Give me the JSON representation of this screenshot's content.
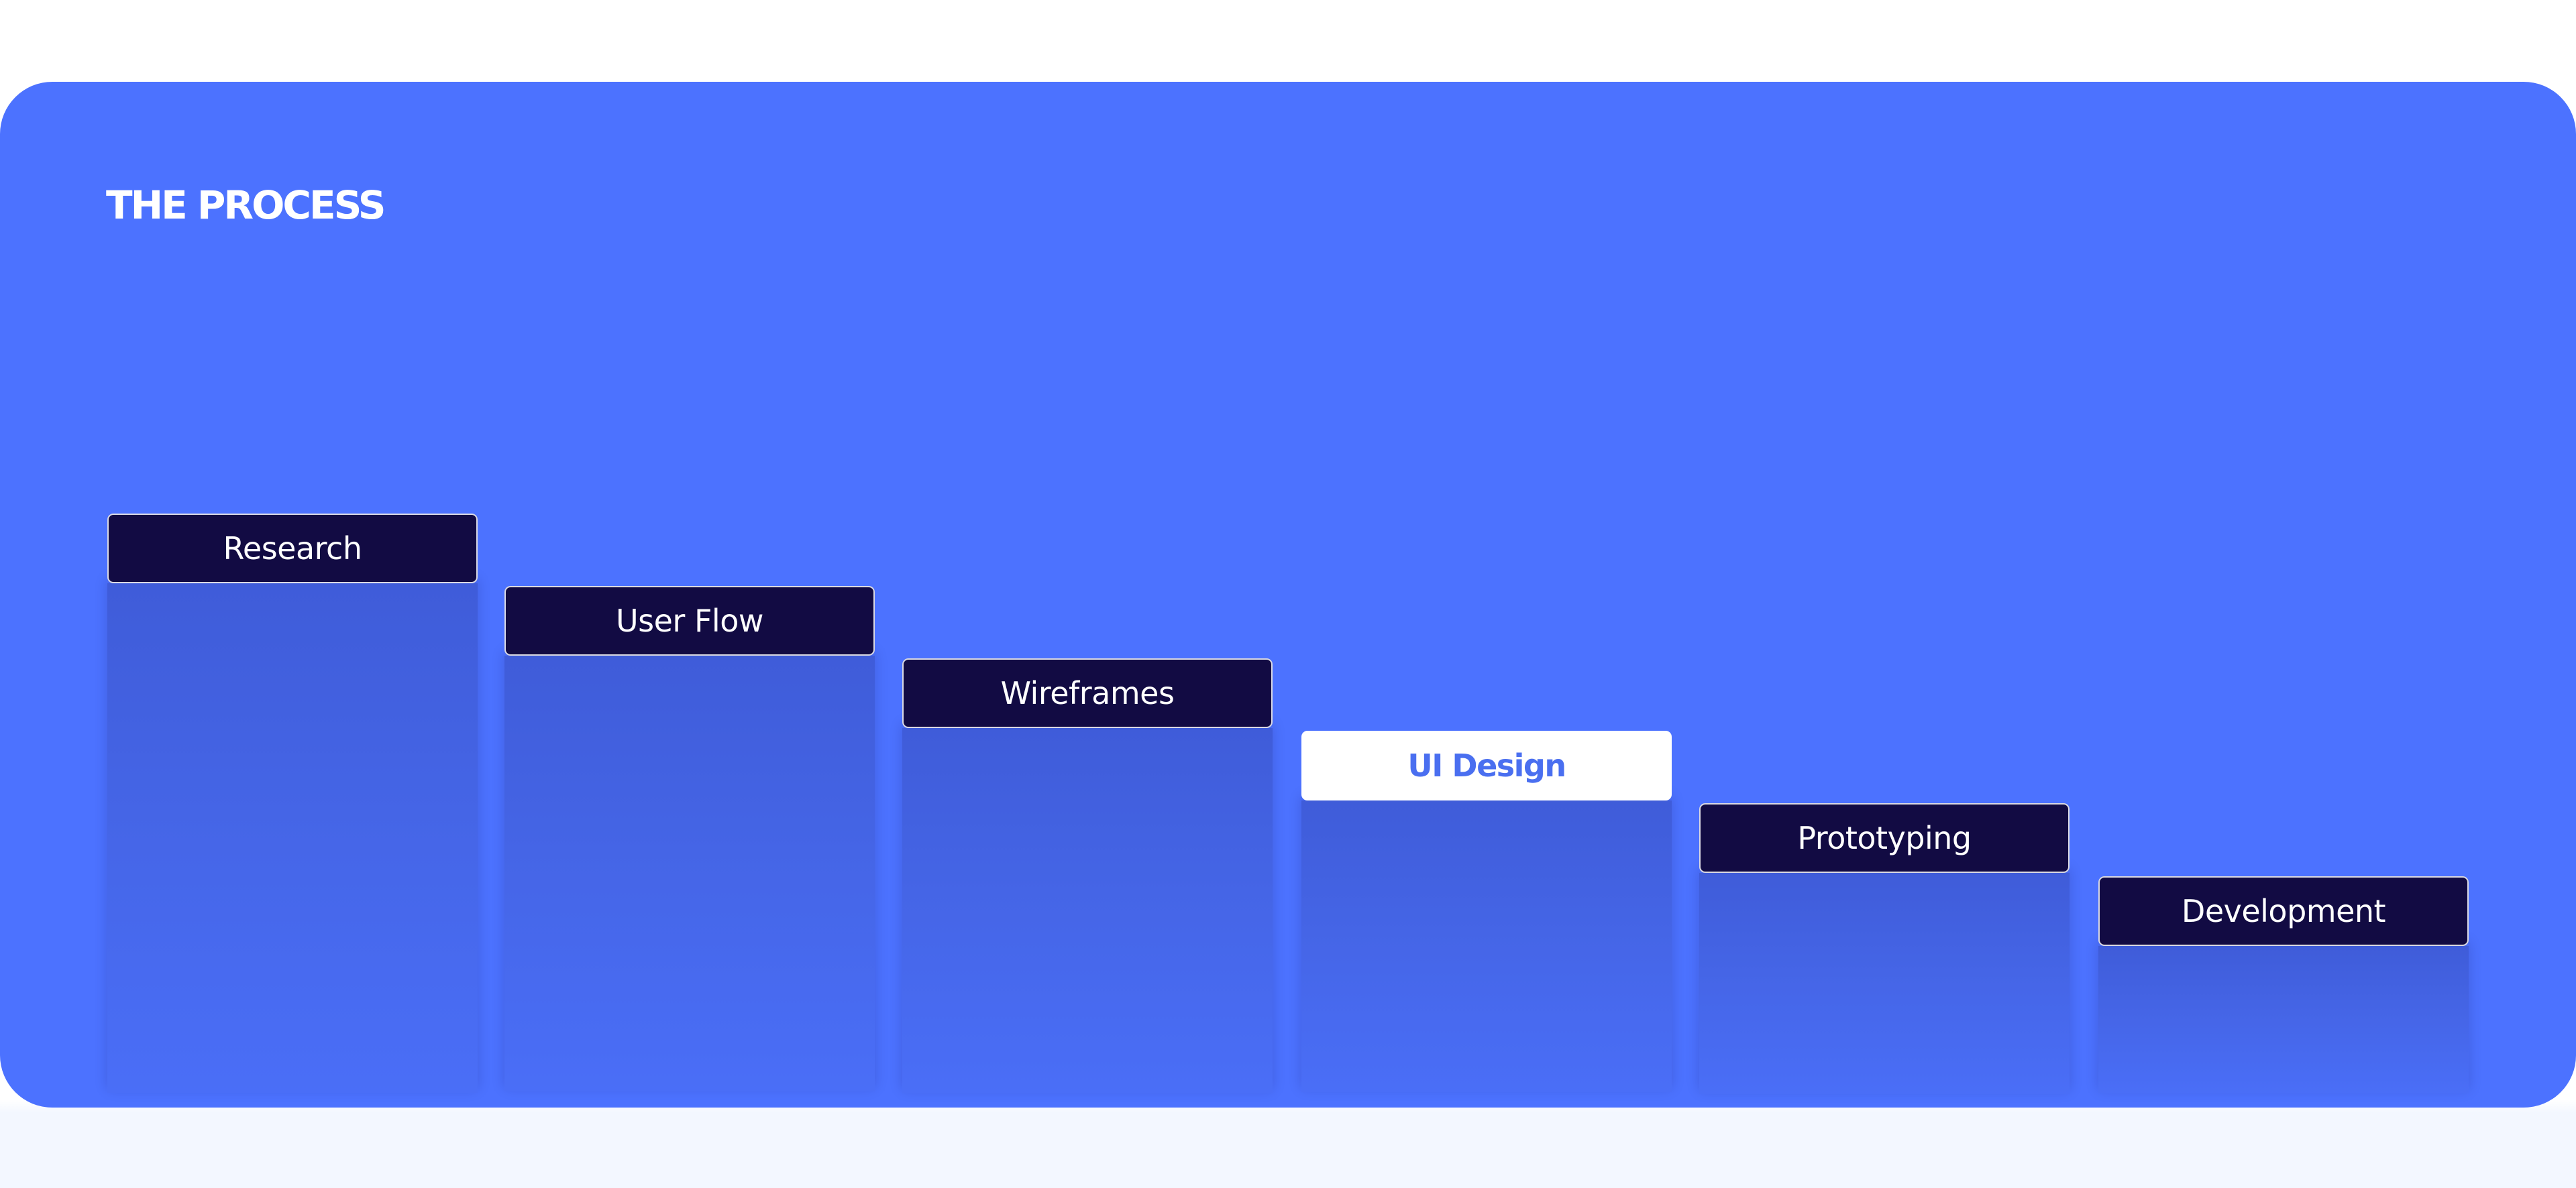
{
  "section": {
    "title": "THE PROCESS"
  },
  "steps": [
    {
      "label": "Research",
      "active": false
    },
    {
      "label": "User Flow",
      "active": false
    },
    {
      "label": "Wireframes",
      "active": false
    },
    {
      "label": "UI Design",
      "active": true
    },
    {
      "label": "Prototyping",
      "active": false
    },
    {
      "label": "Development",
      "active": false
    }
  ],
  "colors": {
    "card_background": "#4c72ff",
    "step_box": "#120b43",
    "active_step_box": "#ffffff",
    "active_step_text": "#4a6ff0",
    "page_background": "#ffffff",
    "footer_background": "#f3f7ff"
  }
}
